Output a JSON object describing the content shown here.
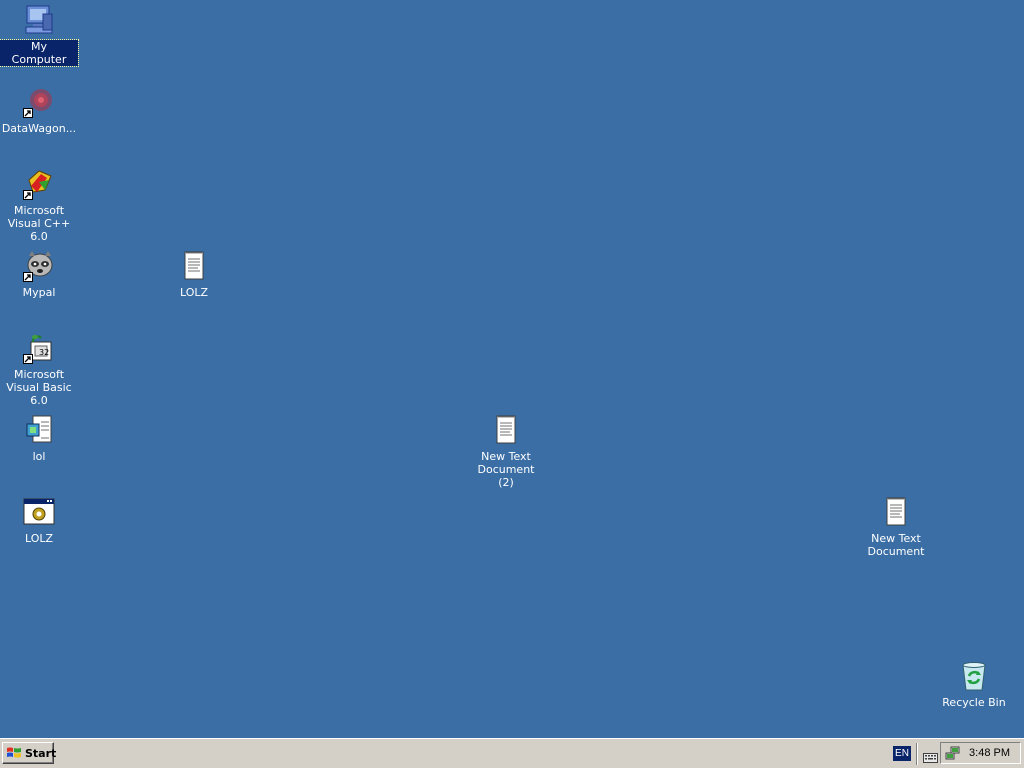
{
  "desktop": {
    "background_color": "#3a6ea5",
    "icons": [
      {
        "label": "My Computer",
        "icon": "computer-icon",
        "selected": true
      },
      {
        "label": "DataWagon...",
        "icon": "datawagon-icon",
        "shortcut": true
      },
      {
        "label": "Microsoft Visual C++ 6.0",
        "icon": "visual-cpp-icon",
        "shortcut": true
      },
      {
        "label": "Mypal",
        "icon": "mypal-icon",
        "shortcut": true
      },
      {
        "label": "LOLZ",
        "icon": "text-document-icon"
      },
      {
        "label": "Microsoft Visual Basic 6.0",
        "icon": "visual-basic-icon",
        "shortcut": true
      },
      {
        "label": "lol",
        "icon": "script-file-icon"
      },
      {
        "label": "New Text Document (2)",
        "icon": "text-document-icon"
      },
      {
        "label": "LOLZ",
        "icon": "application-icon"
      },
      {
        "label": "New Text Document",
        "icon": "text-document-icon"
      },
      {
        "label": "Recycle Bin",
        "icon": "recycle-bin-icon"
      }
    ]
  },
  "taskbar": {
    "start_label": "Start",
    "language": "EN",
    "clock": "3:48 PM",
    "tray_icons": [
      "keyboard-icon",
      "network-icon"
    ]
  }
}
